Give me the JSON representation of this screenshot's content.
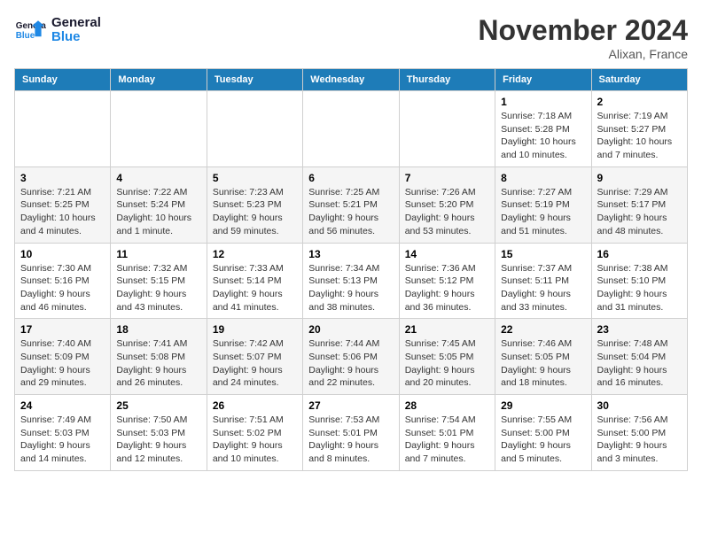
{
  "header": {
    "logo_general": "General",
    "logo_blue": "Blue",
    "month": "November 2024",
    "location": "Alixan, France"
  },
  "weekdays": [
    "Sunday",
    "Monday",
    "Tuesday",
    "Wednesday",
    "Thursday",
    "Friday",
    "Saturday"
  ],
  "weeks": [
    [
      {
        "day": "",
        "info": ""
      },
      {
        "day": "",
        "info": ""
      },
      {
        "day": "",
        "info": ""
      },
      {
        "day": "",
        "info": ""
      },
      {
        "day": "",
        "info": ""
      },
      {
        "day": "1",
        "info": "Sunrise: 7:18 AM\nSunset: 5:28 PM\nDaylight: 10 hours and 10 minutes."
      },
      {
        "day": "2",
        "info": "Sunrise: 7:19 AM\nSunset: 5:27 PM\nDaylight: 10 hours and 7 minutes."
      }
    ],
    [
      {
        "day": "3",
        "info": "Sunrise: 7:21 AM\nSunset: 5:25 PM\nDaylight: 10 hours and 4 minutes."
      },
      {
        "day": "4",
        "info": "Sunrise: 7:22 AM\nSunset: 5:24 PM\nDaylight: 10 hours and 1 minute."
      },
      {
        "day": "5",
        "info": "Sunrise: 7:23 AM\nSunset: 5:23 PM\nDaylight: 9 hours and 59 minutes."
      },
      {
        "day": "6",
        "info": "Sunrise: 7:25 AM\nSunset: 5:21 PM\nDaylight: 9 hours and 56 minutes."
      },
      {
        "day": "7",
        "info": "Sunrise: 7:26 AM\nSunset: 5:20 PM\nDaylight: 9 hours and 53 minutes."
      },
      {
        "day": "8",
        "info": "Sunrise: 7:27 AM\nSunset: 5:19 PM\nDaylight: 9 hours and 51 minutes."
      },
      {
        "day": "9",
        "info": "Sunrise: 7:29 AM\nSunset: 5:17 PM\nDaylight: 9 hours and 48 minutes."
      }
    ],
    [
      {
        "day": "10",
        "info": "Sunrise: 7:30 AM\nSunset: 5:16 PM\nDaylight: 9 hours and 46 minutes."
      },
      {
        "day": "11",
        "info": "Sunrise: 7:32 AM\nSunset: 5:15 PM\nDaylight: 9 hours and 43 minutes."
      },
      {
        "day": "12",
        "info": "Sunrise: 7:33 AM\nSunset: 5:14 PM\nDaylight: 9 hours and 41 minutes."
      },
      {
        "day": "13",
        "info": "Sunrise: 7:34 AM\nSunset: 5:13 PM\nDaylight: 9 hours and 38 minutes."
      },
      {
        "day": "14",
        "info": "Sunrise: 7:36 AM\nSunset: 5:12 PM\nDaylight: 9 hours and 36 minutes."
      },
      {
        "day": "15",
        "info": "Sunrise: 7:37 AM\nSunset: 5:11 PM\nDaylight: 9 hours and 33 minutes."
      },
      {
        "day": "16",
        "info": "Sunrise: 7:38 AM\nSunset: 5:10 PM\nDaylight: 9 hours and 31 minutes."
      }
    ],
    [
      {
        "day": "17",
        "info": "Sunrise: 7:40 AM\nSunset: 5:09 PM\nDaylight: 9 hours and 29 minutes."
      },
      {
        "day": "18",
        "info": "Sunrise: 7:41 AM\nSunset: 5:08 PM\nDaylight: 9 hours and 26 minutes."
      },
      {
        "day": "19",
        "info": "Sunrise: 7:42 AM\nSunset: 5:07 PM\nDaylight: 9 hours and 24 minutes."
      },
      {
        "day": "20",
        "info": "Sunrise: 7:44 AM\nSunset: 5:06 PM\nDaylight: 9 hours and 22 minutes."
      },
      {
        "day": "21",
        "info": "Sunrise: 7:45 AM\nSunset: 5:05 PM\nDaylight: 9 hours and 20 minutes."
      },
      {
        "day": "22",
        "info": "Sunrise: 7:46 AM\nSunset: 5:05 PM\nDaylight: 9 hours and 18 minutes."
      },
      {
        "day": "23",
        "info": "Sunrise: 7:48 AM\nSunset: 5:04 PM\nDaylight: 9 hours and 16 minutes."
      }
    ],
    [
      {
        "day": "24",
        "info": "Sunrise: 7:49 AM\nSunset: 5:03 PM\nDaylight: 9 hours and 14 minutes."
      },
      {
        "day": "25",
        "info": "Sunrise: 7:50 AM\nSunset: 5:03 PM\nDaylight: 9 hours and 12 minutes."
      },
      {
        "day": "26",
        "info": "Sunrise: 7:51 AM\nSunset: 5:02 PM\nDaylight: 9 hours and 10 minutes."
      },
      {
        "day": "27",
        "info": "Sunrise: 7:53 AM\nSunset: 5:01 PM\nDaylight: 9 hours and 8 minutes."
      },
      {
        "day": "28",
        "info": "Sunrise: 7:54 AM\nSunset: 5:01 PM\nDaylight: 9 hours and 7 minutes."
      },
      {
        "day": "29",
        "info": "Sunrise: 7:55 AM\nSunset: 5:00 PM\nDaylight: 9 hours and 5 minutes."
      },
      {
        "day": "30",
        "info": "Sunrise: 7:56 AM\nSunset: 5:00 PM\nDaylight: 9 hours and 3 minutes."
      }
    ]
  ]
}
